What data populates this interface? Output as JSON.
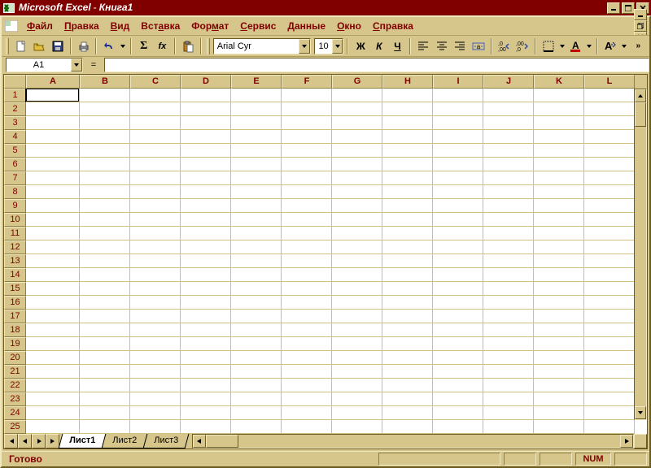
{
  "titlebar": {
    "app": "Microsoft Excel",
    "doc": "Книга1"
  },
  "menubar": {
    "items": [
      {
        "u": "Ф",
        "rest": "айл"
      },
      {
        "u": "П",
        "rest": "равка"
      },
      {
        "u": "В",
        "rest": "ид"
      },
      {
        "pre": "Вст",
        "u": "а",
        "rest": "вка"
      },
      {
        "pre": "Фор",
        "u": "м",
        "rest": "ат"
      },
      {
        "u": "С",
        "rest": "ервис"
      },
      {
        "u": "Д",
        "rest": "анные"
      },
      {
        "u": "О",
        "rest": "кно"
      },
      {
        "u": "С",
        "rest": "правка"
      }
    ]
  },
  "namebox": {
    "value": "A1"
  },
  "formula": {
    "value": ""
  },
  "font": {
    "name": "Arial Cyr",
    "size": "10"
  },
  "toolbar": {
    "bold": "Ж",
    "italic": "К",
    "underline": "Ч",
    "inc_dec_labels": [
      ",0",
      ",00"
    ],
    "fx": "fx"
  },
  "columns": [
    "A",
    "B",
    "C",
    "D",
    "E",
    "F",
    "G",
    "H",
    "I",
    "J",
    "K",
    "L"
  ],
  "rows": [
    "1",
    "2",
    "3",
    "4",
    "5",
    "6",
    "7",
    "8",
    "9",
    "10",
    "11",
    "12",
    "13",
    "14",
    "15",
    "16",
    "17",
    "18",
    "19",
    "20",
    "21",
    "22",
    "23",
    "24",
    "25"
  ],
  "sheets": {
    "tabs": [
      "Лист1",
      "Лист2",
      "Лист3"
    ],
    "active": 0
  },
  "status": {
    "msg": "Готово",
    "num": "NUM"
  },
  "selection": {
    "cell": "A1"
  },
  "colors": {
    "accent": "#800000",
    "ui": "#d6c68c"
  }
}
